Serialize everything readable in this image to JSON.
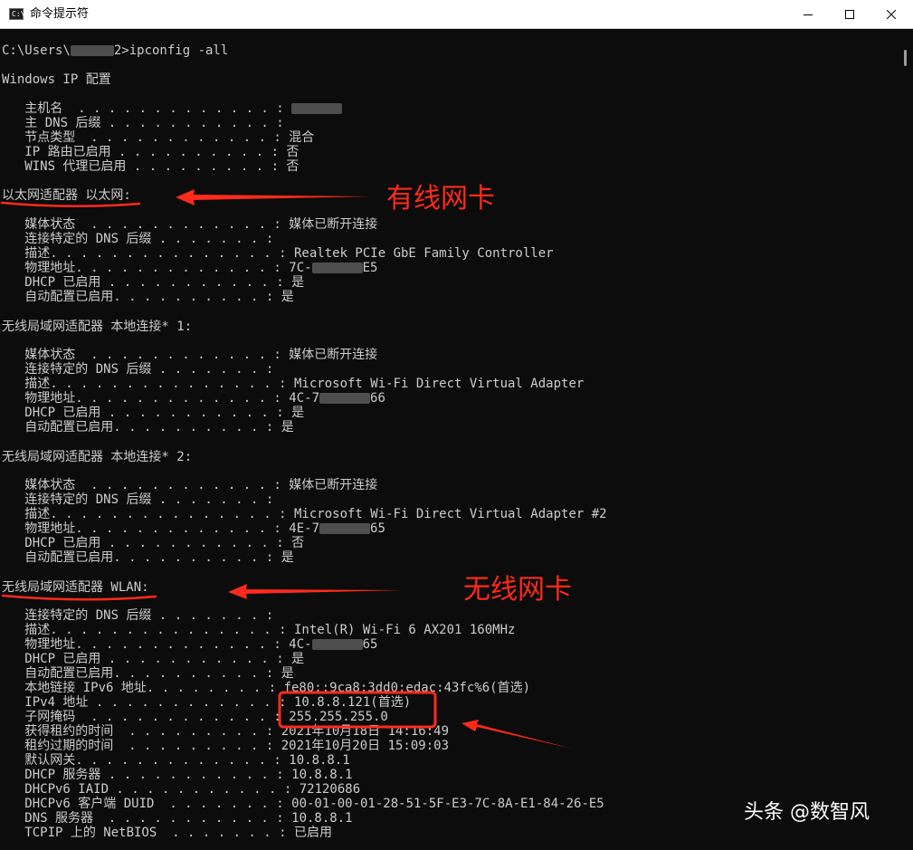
{
  "window": {
    "title": "命令提示符",
    "icon_label": "C:\\",
    "icon": "cmd-icon"
  },
  "controls": {
    "minimize_icon": "minimize-icon",
    "maximize_icon": "maximize-icon",
    "close_icon": "close-icon"
  },
  "colors": {
    "terminal_bg": "#0c0c0c",
    "terminal_text": "#cccccc",
    "annotation_red": "#ff2a1a"
  },
  "terminal": {
    "prompt_before": "C:\\Users\\",
    "prompt_after": "2>ipconfig -all",
    "lines": [
      "Windows IP 配置",
      "   主机名  . . . . . . . . . . . . . : ",
      "   主 DNS 后缀 . . . . . . . . . . . :",
      "   节点类型  . . . . . . . . . . . . : 混合",
      "   IP 路由已启用 . . . . . . . . . . : 否",
      "   WINS 代理已启用 . . . . . . . . . : 否",
      "以太网适配器 以太网:",
      "   媒体状态  . . . . . . . . . . . . : 媒体已断开连接",
      "   连接特定的 DNS 后缀 . . . . . . . :",
      "   描述. . . . . . . . . . . . . . . : Realtek PCIe GbE Family Controller",
      "   物理地址. . . . . . . . . . . . . : 7C-",
      "   DHCP 已启用 . . . . . . . . . . . : 是",
      "   自动配置已启用. . . . . . . . . . : 是",
      "无线局域网适配器 本地连接* 1:",
      "   媒体状态  . . . . . . . . . . . . : 媒体已断开连接",
      "   连接特定的 DNS 后缀 . . . . . . . :",
      "   描述. . . . . . . . . . . . . . . : Microsoft Wi-Fi Direct Virtual Adapter",
      "   物理地址. . . . . . . . . . . . . : 4C-7",
      "   DHCP 已启用 . . . . . . . . . . . : 是",
      "   自动配置已启用. . . . . . . . . . : 是",
      "无线局域网适配器 本地连接* 2:",
      "   媒体状态  . . . . . . . . . . . . : 媒体已断开连接",
      "   连接特定的 DNS 后缀 . . . . . . . :",
      "   描述. . . . . . . . . . . . . . . : Microsoft Wi-Fi Direct Virtual Adapter #2",
      "   物理地址. . . . . . . . . . . . . : 4E-7",
      "   DHCP 已启用 . . . . . . . . . . . : 否",
      "   自动配置已启用. . . . . . . . . . : 是",
      "无线局域网适配器 WLAN:",
      "   连接特定的 DNS 后缀 . . . . . . . :",
      "   描述. . . . . . . . . . . . . . . : Intel(R) Wi-Fi 6 AX201 160MHz",
      "   物理地址. . . . . . . . . . . . . : 4C-",
      "   DHCP 已启用 . . . . . . . . . . . : 是",
      "   自动配置已启用. . . . . . . . . . : 是",
      "   本地链接 IPv6 地址. . . . . . . . : fe80::9ca8:3dd0:edac:43fc%6(首选)",
      "   IPv4 地址 . . . . . . . . . . . . : 10.8.8.121(首选)",
      "   子网掩码  . . . . . . . . . . . . : 255.255.255.0",
      "   获得租约的时间  . . . . . . . . . : 2021年10月18日 14:16:49",
      "   租约过期的时间  . . . . . . . . . : 2021年10月20日 15:09:03",
      "   默认网关. . . . . . . . . . . . . : 10.8.8.1",
      "   DHCP 服务器 . . . . . . . . . . . : 10.8.8.1",
      "   DHCPv6 IAID . . . . . . . . . . . : 72120686",
      "   DHCPv6 客户端 DUID  . . . . . . . : 00-01-00-01-28-51-5F-E3-7C-8A-E1-84-26-E5",
      "   DNS 服务器  . . . . . . . . . . . : 10.8.8.1",
      "   TCPIP 上的 NetBIOS  . . . . . . . : 已启用"
    ],
    "mac_suffixes": {
      "ethernet": "E5",
      "local1": "66",
      "local2": "65",
      "wlan": "65"
    }
  },
  "annotations": {
    "wired_label": "有线网卡",
    "wireless_label": "无线网卡"
  },
  "watermark": "头条 @数智风"
}
